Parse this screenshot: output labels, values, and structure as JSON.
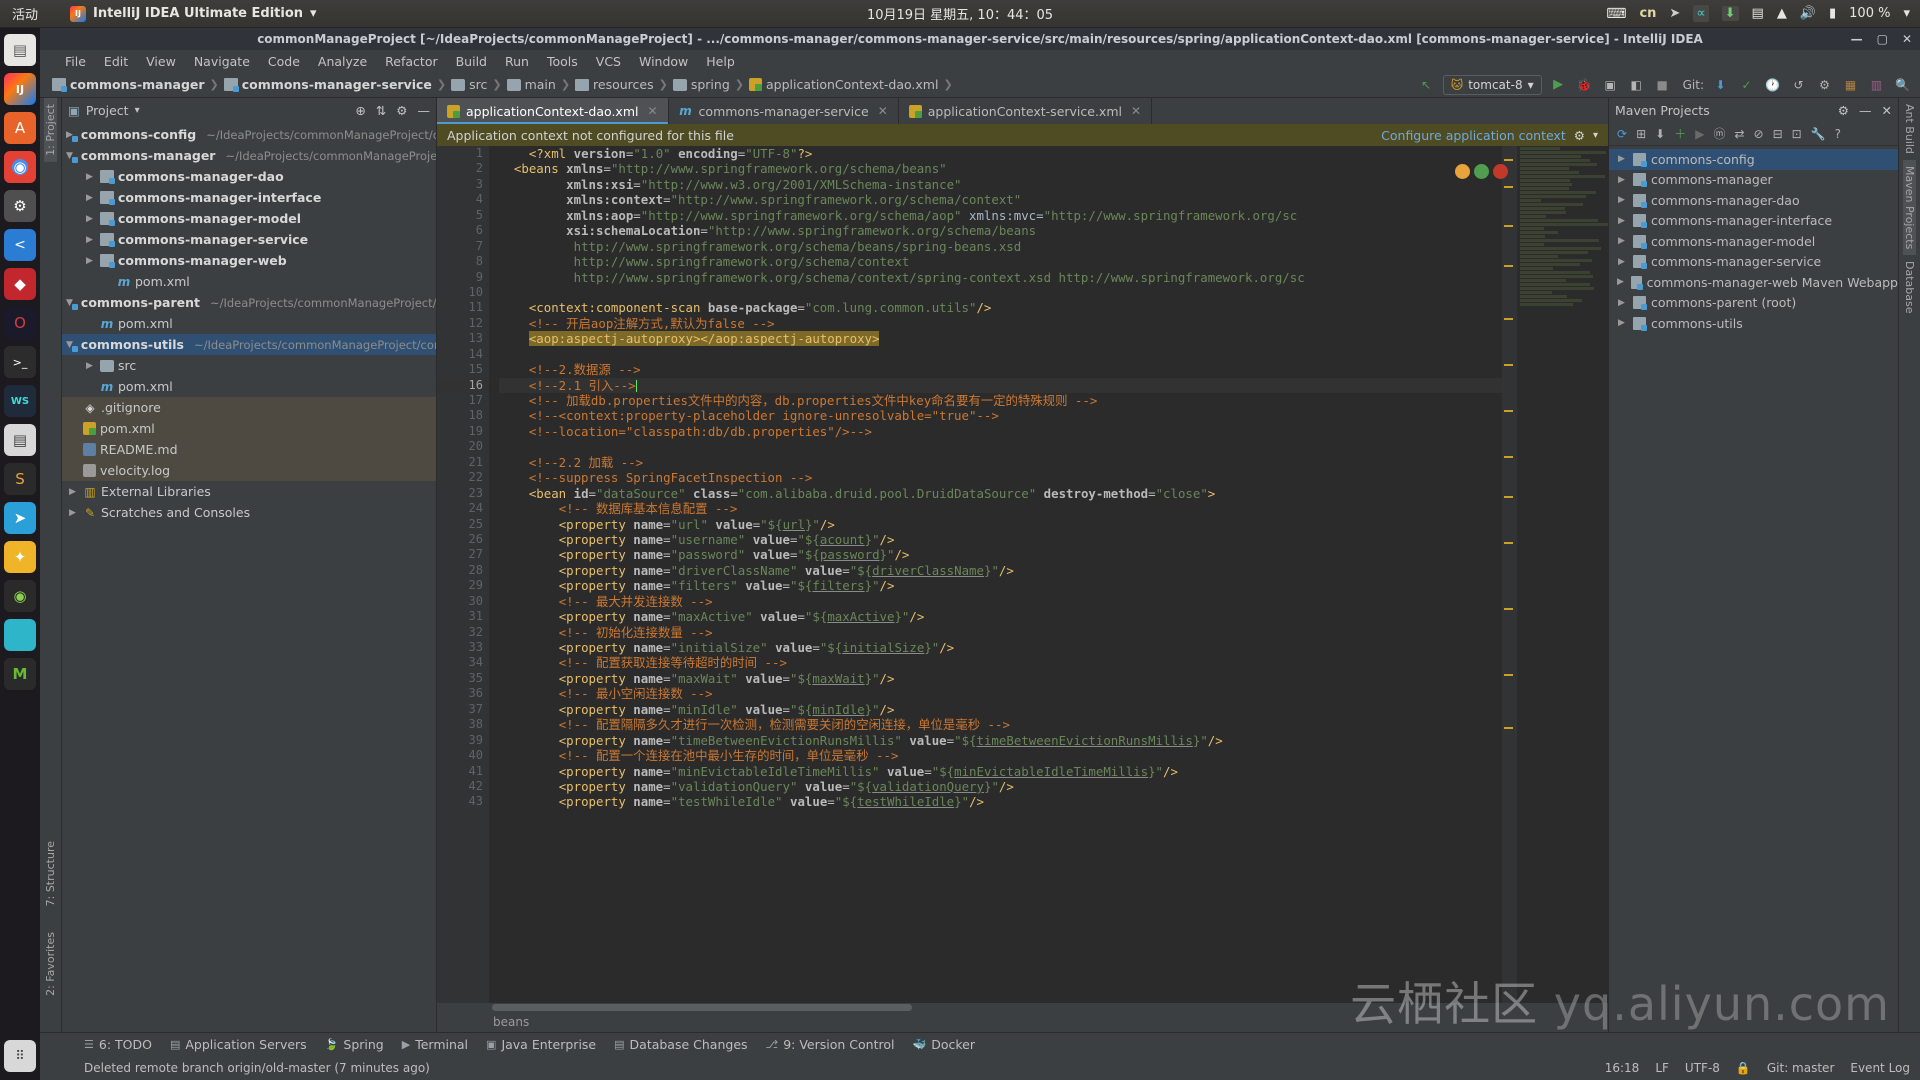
{
  "gnome": {
    "activities": "活动",
    "app_name": "IntelliJ IDEA Ultimate Edition",
    "app_dropdown": "▾",
    "clock": "10月19日 星期五, 10：44：05",
    "tray": {
      "keyboard_label": "cn",
      "battery_percent": "100 %",
      "dropdown": "▾"
    },
    "tray_icons": [
      "keyboard-icon",
      "telegram-icon",
      "anaconda-icon",
      "download-icon",
      "onboard-keyboard-icon",
      "wifi-icon",
      "volume-icon",
      "battery-icon"
    ]
  },
  "dock": {
    "items": [
      "files-icon",
      "intellij-idea-icon",
      "ubuntu-software-icon",
      "chrome-icon",
      "settings-icon",
      "vscode-icon",
      "database-icon",
      "opera-icon",
      "terminal-icon",
      "webstorm-icon",
      "keyboard-app-icon",
      "sublime-icon",
      "telegram-app-icon",
      "sketch-icon",
      "pycharm-icon",
      "screen-icon",
      "mysql-icon",
      "show-apps-icon"
    ]
  },
  "window": {
    "title": "commonManageProject [~/IdeaProjects/commonManageProject] - .../commons-manager/commons-manager-service/src/main/resources/spring/applicationContext-dao.xml [commons-manager-service] - IntelliJ IDEA",
    "minimize": "—",
    "maximize": "▢",
    "close": "✕"
  },
  "menubar": {
    "items": [
      "File",
      "Edit",
      "View",
      "Navigate",
      "Code",
      "Analyze",
      "Refactor",
      "Build",
      "Run",
      "Tools",
      "VCS",
      "Window",
      "Help"
    ]
  },
  "navbar": {
    "crumbs": [
      {
        "label": "commons-manager",
        "icon": "module-icon",
        "bold": true
      },
      {
        "label": "commons-manager-service",
        "icon": "module-icon",
        "bold": true
      },
      {
        "label": "src",
        "icon": "folder-icon",
        "bold": false
      },
      {
        "label": "main",
        "icon": "folder-icon",
        "bold": false
      },
      {
        "label": "resources",
        "icon": "resources-folder-icon",
        "bold": false
      },
      {
        "label": "spring",
        "icon": "folder-icon",
        "bold": false
      },
      {
        "label": "applicationContext-dao.xml",
        "icon": "xml-file-icon",
        "bold": false
      }
    ],
    "run_config": "tomcat-8",
    "run_config_caret": "▾",
    "git_label": "Git:",
    "icons_left": [
      "build-icon",
      "run-icon",
      "debug-icon",
      "run-with-coverage-icon",
      "profiler-icon",
      "stop-icon"
    ],
    "icons_right": [
      "update-project-icon",
      "commit-icon",
      "revert-icon",
      "history-icon",
      "search-everywhere-icon",
      "settings-icon",
      "project-structure-icon",
      "magnifier-icon"
    ]
  },
  "left_strip": {
    "project": "1: Project",
    "structure": "7: Structure",
    "favorites": "2: Favorites"
  },
  "right_strip": {
    "ant_build": "Ant Build",
    "maven_projects": "Maven Projects",
    "database": "Database"
  },
  "project_panel": {
    "title": "Project",
    "caret": "▾",
    "toolbar_icons": [
      "locate-icon",
      "expand-collapse-icon",
      "settings-icon",
      "hide-icon"
    ],
    "tree": [
      {
        "indent": 0,
        "arrow": "▶",
        "icon": "module-icon",
        "name": "commons-config",
        "path": "~/IdeaProjects/commonManageProject/con",
        "bold": true,
        "state": "normal"
      },
      {
        "indent": 0,
        "arrow": "▼",
        "icon": "module-icon",
        "name": "commons-manager",
        "path": "~/IdeaProjects/commonManageProject/c",
        "bold": true,
        "state": "normal"
      },
      {
        "indent": 1,
        "arrow": "▶",
        "icon": "module-icon",
        "name": "commons-manager-dao",
        "path": "",
        "bold": true,
        "state": "normal"
      },
      {
        "indent": 1,
        "arrow": "▶",
        "icon": "module-icon",
        "name": "commons-manager-interface",
        "path": "",
        "bold": true,
        "state": "normal"
      },
      {
        "indent": 1,
        "arrow": "▶",
        "icon": "module-icon",
        "name": "commons-manager-model",
        "path": "",
        "bold": true,
        "state": "normal"
      },
      {
        "indent": 1,
        "arrow": "▶",
        "icon": "module-icon",
        "name": "commons-manager-service",
        "path": "",
        "bold": true,
        "state": "normal"
      },
      {
        "indent": 1,
        "arrow": "▶",
        "icon": "module-icon",
        "name": "commons-manager-web",
        "path": "",
        "bold": true,
        "state": "normal"
      },
      {
        "indent": 2,
        "arrow": "",
        "icon": "maven-file-icon",
        "name": "pom.xml",
        "path": "",
        "bold": false,
        "state": "normal"
      },
      {
        "indent": 0,
        "arrow": "▼",
        "icon": "module-icon",
        "name": "commons-parent",
        "path": "~/IdeaProjects/commonManageProject/co",
        "bold": true,
        "state": "normal"
      },
      {
        "indent": 1,
        "arrow": "",
        "icon": "maven-file-icon",
        "name": "pom.xml",
        "path": "",
        "bold": false,
        "state": "normal"
      },
      {
        "indent": 0,
        "arrow": "▼",
        "icon": "module-icon",
        "name": "commons-utils",
        "path": "~/IdeaProjects/commonManageProject/comm",
        "bold": true,
        "state": "selected"
      },
      {
        "indent": 1,
        "arrow": "▶",
        "icon": "folder-icon",
        "name": "src",
        "path": "",
        "bold": false,
        "state": "normal"
      },
      {
        "indent": 1,
        "arrow": "",
        "icon": "maven-file-icon",
        "name": "pom.xml",
        "path": "",
        "bold": false,
        "state": "normal"
      },
      {
        "indent": 0,
        "arrow": "",
        "icon": "git-icon",
        "name": ".gitignore",
        "path": "",
        "bold": false,
        "state": "highlight"
      },
      {
        "indent": 0,
        "arrow": "",
        "icon": "maven-xml-icon",
        "name": "pom.xml",
        "path": "",
        "bold": false,
        "state": "highlight"
      },
      {
        "indent": 0,
        "arrow": "",
        "icon": "markdown-icon",
        "name": "README.md",
        "path": "",
        "bold": false,
        "state": "highlight"
      },
      {
        "indent": 0,
        "arrow": "",
        "icon": "log-file-icon",
        "name": "velocity.log",
        "path": "",
        "bold": false,
        "state": "highlight"
      },
      {
        "indent": 0,
        "arrow": "▶",
        "icon": "library-icon",
        "name": "External Libraries",
        "path": "",
        "bold": false,
        "state": "normal"
      },
      {
        "indent": 0,
        "arrow": "▶",
        "icon": "scratches-icon",
        "name": "Scratches and Consoles",
        "path": "",
        "bold": false,
        "state": "normal"
      }
    ]
  },
  "editor": {
    "tabs": [
      {
        "label": "applicationContext-dao.xml",
        "icon": "xml-file-icon",
        "active": true,
        "close": "✕"
      },
      {
        "label": "commons-manager-service",
        "icon": "maven-module-icon",
        "active": false,
        "close": "✕"
      },
      {
        "label": "applicationContext-service.xml",
        "icon": "xml-file-icon",
        "active": false,
        "close": "✕"
      }
    ],
    "banner": {
      "message": "Application context not configured for this file",
      "link": "Configure application context",
      "gear": "⚙",
      "caret": "▾"
    },
    "bottom_breadcrumb": "beans",
    "current_line": 16,
    "lines": [
      {
        "n": 1,
        "html": "    <span class='t-tag'>&lt;?xml</span> <span class='t-attr'>version</span>=<span class='t-val'>\"1.0\"</span> <span class='t-attr'>encoding</span>=<span class='t-val'>\"UTF-8\"</span><span class='t-tag'>?&gt;</span>"
      },
      {
        "n": 2,
        "html": "  <span class='t-tag'>&lt;beans</span> <span class='t-attr'>xmlns</span>=<span class='t-val'>\"http://www.springframework.org/schema/beans\"</span>"
      },
      {
        "n": 3,
        "html": "         <span class='t-attr'>xmlns:xsi</span>=<span class='t-val'>\"http://www.w3.org/2001/XMLSchema-instance\"</span>"
      },
      {
        "n": 4,
        "html": "         <span class='t-attr'>xmlns:context</span>=<span class='t-val'>\"http://www.springframework.org/schema/context\"</span>"
      },
      {
        "n": 5,
        "html": "         <span class='t-attr'>xmlns:aop</span>=<span class='t-val'>\"http://www.springframework.org/schema/aop\"</span> <span class='t-txt'>xmlns:mvc=</span><span class='t-val'>\"http://www.springframework.org/sc</span>"
      },
      {
        "n": 6,
        "html": "         <span class='t-attr'>xsi:schemaLocation</span>=<span class='t-val'>\"http://www.springframework.org/schema/beans</span>"
      },
      {
        "n": 7,
        "html": "          <span class='t-val'>http://www.springframework.org/schema/beans/spring-beans.xsd</span>"
      },
      {
        "n": 8,
        "html": "          <span class='t-val'>http://www.springframework.org/schema/context</span>"
      },
      {
        "n": 9,
        "html": "          <span class='t-val'>http://www.springframework.org/schema/context/spring-context.xsd http://www.springframework.org/sc</span>"
      },
      {
        "n": 10,
        "html": ""
      },
      {
        "n": 11,
        "html": "    <span class='t-tag'>&lt;context:component-scan</span> <span class='t-attr'>base-package</span>=<span class='t-val'>\"com.lung.common.utils\"</span><span class='t-tag'>/&gt;</span>"
      },
      {
        "n": 12,
        "html": "    <span class='t-com'>&lt;!-- 开启aop注解方式,默认为false --&gt;</span>"
      },
      {
        "n": 13,
        "html": "    <span class='t-hl'><span class='t-tag'>&lt;aop:aspectj-autoproxy&gt;</span><span class='t-tag'>&lt;/aop:aspectj-autoproxy&gt;</span></span>"
      },
      {
        "n": 14,
        "html": ""
      },
      {
        "n": 15,
        "html": "    <span class='t-com'>&lt;!--2.数据源 --&gt;</span>"
      },
      {
        "n": 16,
        "html": "    <span class='t-com'>&lt;!--2.1 引入--&gt;</span><span class='caret'></span>"
      },
      {
        "n": 17,
        "html": "    <span class='t-com'>&lt;!-- 加载db.properties文件中的内容，db.properties文件中key命名要有一定的特殊规则 --&gt;</span>"
      },
      {
        "n": 18,
        "html": "    <span class='t-com'>&lt;!--&lt;context:property-placeholder ignore-unresolvable=\"true\"--&gt;</span>"
      },
      {
        "n": 19,
        "html": "    <span class='t-com'>&lt;!--location=\"classpath:db/db.properties\"/&gt;--&gt;</span>"
      },
      {
        "n": 20,
        "html": ""
      },
      {
        "n": 21,
        "html": "    <span class='t-com'>&lt;!--2.2 加载 --&gt;</span>"
      },
      {
        "n": 22,
        "html": "    <span class='t-com'>&lt;!--suppress SpringFacetInspection --&gt;</span>"
      },
      {
        "n": 23,
        "html": "    <span class='t-tag'>&lt;bean</span> <span class='t-attr'>id</span>=<span class='t-val'>\"dataSource\"</span> <span class='t-attr'>class</span>=<span class='t-val'>\"com.alibaba.druid.pool.DruidDataSource\"</span> <span class='t-attr'>destroy-method</span>=<span class='t-val'>\"close\"</span><span class='t-tag'>&gt;</span>"
      },
      {
        "n": 24,
        "html": "        <span class='t-com'>&lt;!-- 数据库基本信息配置 --&gt;</span>"
      },
      {
        "n": 25,
        "html": "        <span class='t-tag'>&lt;property</span> <span class='t-attr'>name</span>=<span class='t-val'>\"url\"</span> <span class='t-attr'>value</span>=<span class='t-val'>\"${<span class='t-und'>url</span>}\"</span><span class='t-tag'>/&gt;</span>"
      },
      {
        "n": 26,
        "html": "        <span class='t-tag'>&lt;property</span> <span class='t-attr'>name</span>=<span class='t-val'>\"username\"</span> <span class='t-attr'>value</span>=<span class='t-val'>\"${<span class='t-und'>acount</span>}\"</span><span class='t-tag'>/&gt;</span>"
      },
      {
        "n": 27,
        "html": "        <span class='t-tag'>&lt;property</span> <span class='t-attr'>name</span>=<span class='t-val'>\"password\"</span> <span class='t-attr'>value</span>=<span class='t-val'>\"${<span class='t-und'>password</span>}\"</span><span class='t-tag'>/&gt;</span>"
      },
      {
        "n": 28,
        "html": "        <span class='t-tag'>&lt;property</span> <span class='t-attr'>name</span>=<span class='t-val'>\"driverClassName\"</span> <span class='t-attr'>value</span>=<span class='t-val'>\"${<span class='t-und'>driverClassName</span>}\"</span><span class='t-tag'>/&gt;</span>"
      },
      {
        "n": 29,
        "html": "        <span class='t-tag'>&lt;property</span> <span class='t-attr'>name</span>=<span class='t-val'>\"filters\"</span> <span class='t-attr'>value</span>=<span class='t-val'>\"${<span class='t-und'>filters</span>}\"</span><span class='t-tag'>/&gt;</span>"
      },
      {
        "n": 30,
        "html": "        <span class='t-com'>&lt;!-- 最大并发连接数 --&gt;</span>"
      },
      {
        "n": 31,
        "html": "        <span class='t-tag'>&lt;property</span> <span class='t-attr'>name</span>=<span class='t-val'>\"maxActive\"</span> <span class='t-attr'>value</span>=<span class='t-val'>\"${<span class='t-und'>maxActive</span>}\"</span><span class='t-tag'>/&gt;</span>"
      },
      {
        "n": 32,
        "html": "        <span class='t-com'>&lt;!-- 初始化连接数量 --&gt;</span>"
      },
      {
        "n": 33,
        "html": "        <span class='t-tag'>&lt;property</span> <span class='t-attr'>name</span>=<span class='t-val'>\"initialSize\"</span> <span class='t-attr'>value</span>=<span class='t-val'>\"${<span class='t-und'>initialSize</span>}\"</span><span class='t-tag'>/&gt;</span>"
      },
      {
        "n": 34,
        "html": "        <span class='t-com'>&lt;!-- 配置获取连接等待超时的时间 --&gt;</span>"
      },
      {
        "n": 35,
        "html": "        <span class='t-tag'>&lt;property</span> <span class='t-attr'>name</span>=<span class='t-val'>\"maxWait\"</span> <span class='t-attr'>value</span>=<span class='t-val'>\"${<span class='t-und'>maxWait</span>}\"</span><span class='t-tag'>/&gt;</span>"
      },
      {
        "n": 36,
        "html": "        <span class='t-com'>&lt;!-- 最小空闲连接数 --&gt;</span>"
      },
      {
        "n": 37,
        "html": "        <span class='t-tag'>&lt;property</span> <span class='t-attr'>name</span>=<span class='t-val'>\"minIdle\"</span> <span class='t-attr'>value</span>=<span class='t-val'>\"${<span class='t-und'>minIdle</span>}\"</span><span class='t-tag'>/&gt;</span>"
      },
      {
        "n": 38,
        "html": "        <span class='t-com'>&lt;!-- 配置隔隔多久才进行一次检测，检测需要关闭的空闲连接，单位是毫秒 --&gt;</span>"
      },
      {
        "n": 39,
        "html": "        <span class='t-tag'>&lt;property</span> <span class='t-attr'>name</span>=<span class='t-val'>\"timeBetweenEvictionRunsMillis\"</span> <span class='t-attr'>value</span>=<span class='t-val'>\"${<span class='t-und'>timeBetweenEvictionRunsMillis</span>}\"</span><span class='t-tag'>/&gt;</span>"
      },
      {
        "n": 40,
        "html": "        <span class='t-com'>&lt;!-- 配置一个连接在池中最小生存的时间，单位是毫秒 --&gt;</span>"
      },
      {
        "n": 41,
        "html": "        <span class='t-tag'>&lt;property</span> <span class='t-attr'>name</span>=<span class='t-val'>\"minEvictableIdleTimeMillis\"</span> <span class='t-attr'>value</span>=<span class='t-val'>\"${<span class='t-und'>minEvictableIdleTimeMillis</span>}\"</span><span class='t-tag'>/&gt;</span>"
      },
      {
        "n": 42,
        "html": "        <span class='t-tag'>&lt;property</span> <span class='t-attr'>name</span>=<span class='t-val'>\"validationQuery\"</span> <span class='t-attr'>value</span>=<span class='t-val'>\"${<span class='t-und'>validationQuery</span>}\"</span><span class='t-tag'>/&gt;</span>"
      },
      {
        "n": 43,
        "html": "        <span class='t-tag'>&lt;property</span> <span class='t-attr'>name</span>=<span class='t-val'>\"testWhileIdle\"</span> <span class='t-attr'>value</span>=<span class='t-val'>\"${<span class='t-und'>testWhileIdle</span>}\"</span><span class='t-tag'>/&gt;</span>"
      }
    ]
  },
  "maven_panel": {
    "title": "Maven Projects",
    "toolbar_icons": [
      "reimport-icon",
      "generate-sources-icon",
      "download-sources-icon",
      "add-icon",
      "run-icon",
      "execute-goal-icon",
      "toggle-offline-icon",
      "toggle-skip-tests-icon",
      "collapse-icon",
      "expand-icon",
      "settings-icon",
      "help-icon"
    ],
    "tree": [
      {
        "arrow": "▶",
        "name": "commons-config",
        "selected": true
      },
      {
        "arrow": "▶",
        "name": "commons-manager",
        "selected": false
      },
      {
        "arrow": "▶",
        "name": "commons-manager-dao",
        "selected": false
      },
      {
        "arrow": "▶",
        "name": "commons-manager-interface",
        "selected": false
      },
      {
        "arrow": "▶",
        "name": "commons-manager-model",
        "selected": false
      },
      {
        "arrow": "▶",
        "name": "commons-manager-service",
        "selected": false
      },
      {
        "arrow": "▶",
        "name": "commons-manager-web Maven Webapp",
        "selected": false
      },
      {
        "arrow": "▶",
        "name": "commons-parent (root)",
        "selected": false
      },
      {
        "arrow": "▶",
        "name": "commons-utils",
        "selected": false
      }
    ]
  },
  "bottom_toolwindows": [
    {
      "label": "6: TODO",
      "icon": "todo-icon"
    },
    {
      "label": "Application Servers",
      "icon": "server-icon"
    },
    {
      "label": "Spring",
      "icon": "spring-icon"
    },
    {
      "label": "Terminal",
      "icon": "terminal-icon"
    },
    {
      "label": "Java Enterprise",
      "icon": "java-ee-icon"
    },
    {
      "label": "Database Changes",
      "icon": "database-icon"
    },
    {
      "label": "9: Version Control",
      "icon": "vcs-icon"
    },
    {
      "label": "Docker",
      "icon": "docker-icon"
    }
  ],
  "statusbar": {
    "message": "Deleted remote branch origin/old-master (7 minutes ago)",
    "position": "16:18",
    "line_separator": "LF",
    "encoding": "UTF-8",
    "git_branch": "Git: master",
    "lock": "🔒",
    "event_log": "Event Log"
  },
  "watermark": {
    "cn": "云栖社区",
    "en": "yq.aliyun.com"
  }
}
